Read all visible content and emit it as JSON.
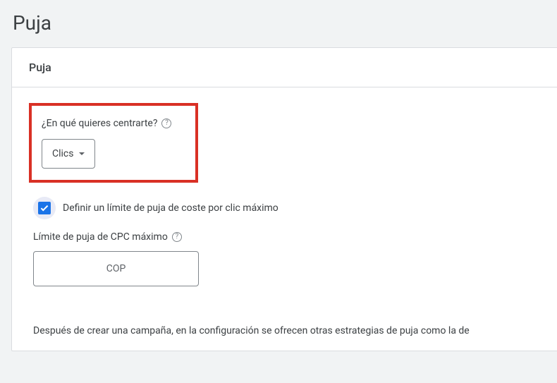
{
  "page": {
    "title": "Puja"
  },
  "card": {
    "header": "Puja",
    "focus": {
      "question": "¿En qué quieres centrarte?",
      "selected": "Clics"
    },
    "checkbox": {
      "label": "Definir un límite de puja de coste por clic máximo",
      "checked": true
    },
    "cpc": {
      "label": "Límite de puja de CPC máximo",
      "currency": "COP"
    },
    "footer": "Después de crear una campaña, en la configuración se ofrecen otras estrategias de puja como la de"
  }
}
